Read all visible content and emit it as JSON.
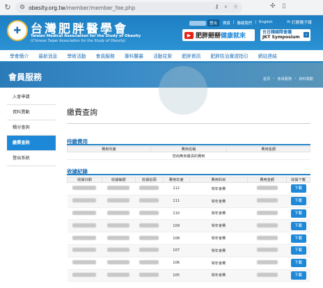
{
  "browser": {
    "url_host": "obesity.org.tw",
    "url_path": "/member/member_fee.php"
  },
  "header": {
    "org_name_zh": "台灣肥胖醫學會",
    "org_name_en": "Taiwan Medical Association for the Study of Obesity",
    "org_name_en2": "(Chinese Taipei Association for the Study of Obesity)",
    "login": "登出",
    "toplinks": [
      "首頁",
      "聯絡我們",
      "English"
    ],
    "subscribe": "訂閱電子報",
    "yt_text1": "肥胖掰掰",
    "yt_text2": "健康就來",
    "jkt_line1": "台日韓國際會議",
    "jkt_line2": "JKT Symposium"
  },
  "nav": [
    "學會簡介",
    "最新消息",
    "學術活動",
    "會員服務",
    "專科醫審",
    "活動花絮",
    "肥胖資訊",
    "肥胖防治實證指引",
    "網站連結"
  ],
  "banner": {
    "title": "會員服務",
    "breadcrumb": [
      "首頁",
      "›",
      "會員服務",
      "›",
      "資料異動"
    ]
  },
  "sidebar": [
    "入會申請",
    "資料異動",
    "積分查詢",
    "繳費查詢",
    "登出系統"
  ],
  "page_title": "繳費查詢",
  "pending": {
    "title": "待繳費用",
    "headers": [
      "費用年度",
      "費用名稱",
      "費用金額"
    ],
    "empty": "您尚無未繳清的費用"
  },
  "records": {
    "title": "收據紀錄",
    "headers": [
      "收據日期",
      "收據編號",
      "收據抬頭",
      "費用年度",
      "費用科目",
      "費用金額",
      "收據下載"
    ],
    "rows": [
      {
        "year": "112",
        "item": "常年會費",
        "dl": "下載"
      },
      {
        "year": "111",
        "item": "常年會費",
        "dl": "下載"
      },
      {
        "year": "110",
        "item": "常年會費",
        "dl": "下載"
      },
      {
        "year": "109",
        "item": "常年會費",
        "dl": "下載"
      },
      {
        "year": "108",
        "item": "常年會費",
        "dl": "下載"
      },
      {
        "year": "107",
        "item": "常年會費",
        "dl": "下載"
      },
      {
        "year": "106",
        "item": "常年會費",
        "dl": "下載"
      },
      {
        "year": "105",
        "item": "常年會費",
        "dl": "下載"
      }
    ]
  }
}
